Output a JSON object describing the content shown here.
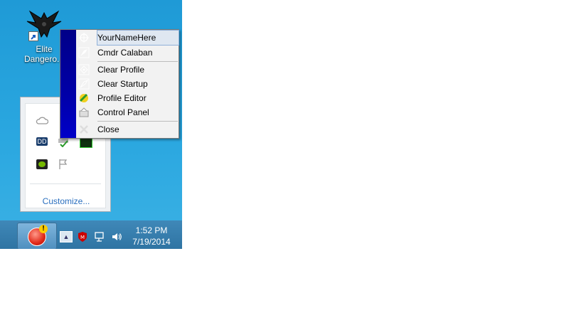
{
  "desktop": {
    "shortcut": {
      "label_line1": "Elite",
      "label_line2": "Dangero..."
    }
  },
  "tray_panel": {
    "icons": [
      "onedrive-icon",
      "dolby-icon",
      "printer-check-icon",
      "green-app-icon",
      "nvidia-icon",
      "flag-icon"
    ],
    "customize_label": "Customize..."
  },
  "context_menu": {
    "items": [
      {
        "label": "YourNameHere",
        "icon": "crosshair-icon",
        "selected": true
      },
      {
        "label": "Cmdr Calaban",
        "icon": "ship-icon"
      },
      {
        "label": "Clear Profile",
        "icon": "crosshair-clear-icon"
      },
      {
        "label": "Clear Startup",
        "icon": "ship-clear-icon"
      },
      {
        "label": "Profile Editor",
        "icon": "editor-icon"
      },
      {
        "label": "Control Panel",
        "icon": "control-panel-icon"
      },
      {
        "label": "Close",
        "icon": "close-icon"
      }
    ]
  },
  "taskbar": {
    "clock_time": "1:52 PM",
    "clock_date": "7/19/2014",
    "tray_icons": [
      "mcafee-icon",
      "network-icon",
      "volume-icon"
    ],
    "start_warning": "!"
  },
  "colors": {
    "menu_sidebar": "#0000a8",
    "selection": "#dfe7f1",
    "link": "#2a6fbf",
    "taskbar": "#2f74a3"
  }
}
